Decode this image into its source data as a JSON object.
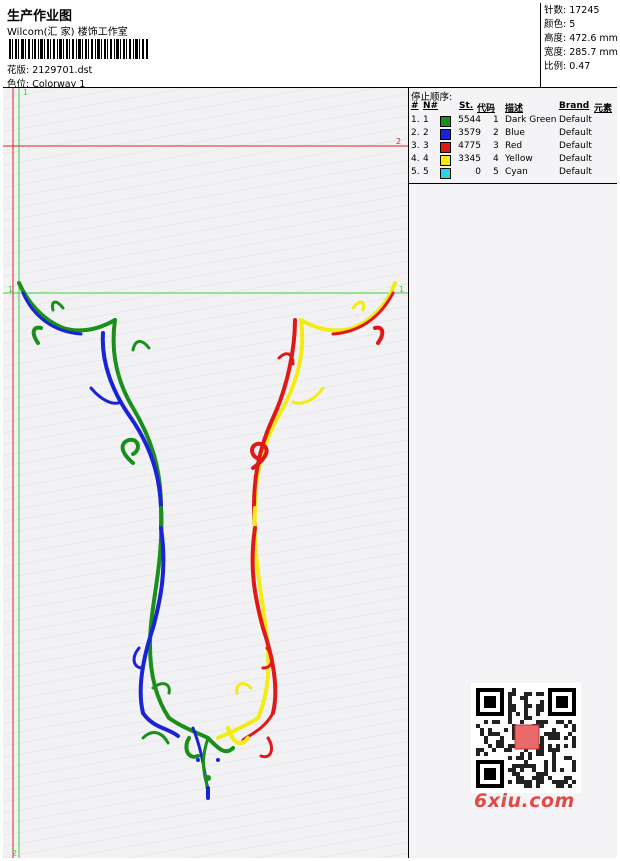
{
  "header": {
    "title": "生产作业图",
    "company": "Wilcom(汇 家) 楼饰工作室",
    "design_label": "花版:",
    "design_value": "2129701.dst",
    "colorway_label": "色位:",
    "colorway_value": "Colorway 1"
  },
  "stats": {
    "stitches_label": "针数:",
    "stitches_value": "17245",
    "colors_label": "颜色:",
    "colors_value": "5",
    "height_label": "高度:",
    "height_value": "472.6 mm",
    "width_label": "宽度:",
    "width_value": "285.7 mm",
    "scale_label": "比例:",
    "scale_value": "0.47"
  },
  "stop_sequence": {
    "label": "停止顺序:",
    "headers": {
      "hash": "#",
      "no": "N#",
      "st": "St.",
      "code": "代码",
      "desc": "描述",
      "brand": "Brand",
      "elem": "元素"
    },
    "rows": [
      {
        "idx": "1.",
        "n": "1",
        "color": "#1a8f1a",
        "st": "5544",
        "code": "1",
        "desc": "Dark Green",
        "brand": "Default"
      },
      {
        "idx": "2.",
        "n": "2",
        "color": "#1a24d6",
        "st": "3579",
        "code": "2",
        "desc": "Blue",
        "brand": "Default"
      },
      {
        "idx": "3.",
        "n": "3",
        "color": "#e01818",
        "st": "4775",
        "code": "3",
        "desc": "Red",
        "brand": "Default"
      },
      {
        "idx": "4.",
        "n": "4",
        "color": "#f2ec12",
        "st": "3345",
        "code": "4",
        "desc": "Yellow",
        "brand": "Default"
      },
      {
        "idx": "5.",
        "n": "5",
        "color": "#28d8e0",
        "st": "0",
        "code": "5",
        "desc": "Cyan",
        "brand": "Default"
      }
    ]
  },
  "guides": {
    "top_label": "1",
    "red_label": "2",
    "green_left_label": "1",
    "green_right_label": "1",
    "bottom_label": "2"
  },
  "watermark": {
    "text": "6xiu.com"
  },
  "colors": {
    "green": "#1a8f1a",
    "blue": "#1a24d6",
    "red": "#e01818",
    "yellow": "#f2ec12",
    "guide_green": "#3ad23a",
    "guide_red": "#e02020"
  }
}
